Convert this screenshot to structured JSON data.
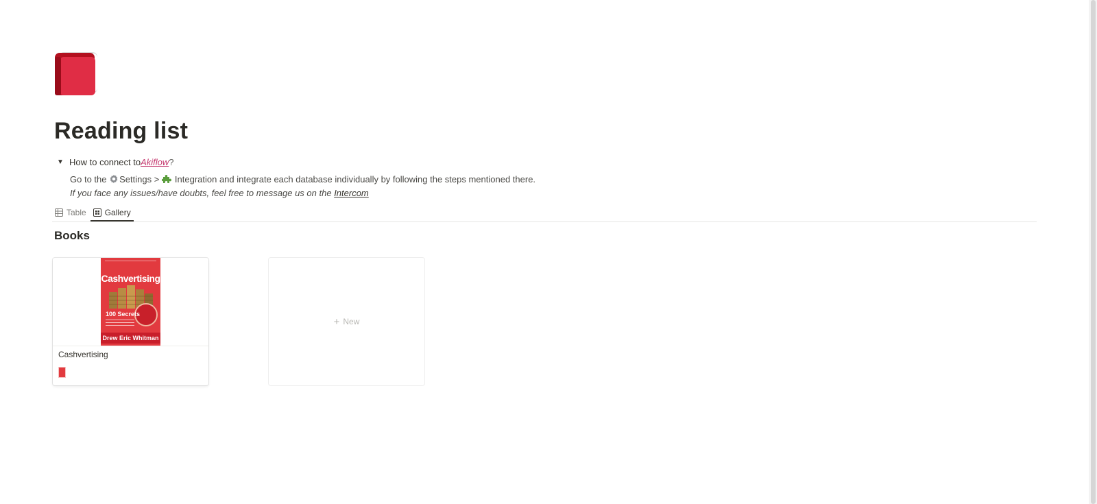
{
  "page": {
    "title": "Reading list",
    "icon": "red-book-icon"
  },
  "toggle": {
    "heading_prefix": "How to connect to ",
    "heading_link": "Akiflow",
    "heading_suffix": "?",
    "line1_prefix": "Go to the ",
    "line1_settings": "Settings",
    "line1_sep": " > ",
    "line1_rest": "Integration and integrate each database individually by following the steps mentioned there.",
    "line2_prefix": "If you face any issues/have doubts, feel free to message us on the ",
    "line2_link": "Intercom"
  },
  "tabs": [
    {
      "label": "Table",
      "icon": "table-icon",
      "active": false
    },
    {
      "label": "Gallery",
      "icon": "gallery-icon",
      "active": true
    }
  ],
  "section": {
    "title": "Books"
  },
  "gallery": {
    "cards": [
      {
        "name": "Cashvertising",
        "cover": {
          "title": "Cashvertising",
          "headline": "100 Secrets",
          "author": "Drew Eric Whitman"
        }
      }
    ],
    "new_label": "New"
  },
  "colors": {
    "link_pink": "#c4376d",
    "text": "#37352f",
    "cover_red": "#e23a3f"
  }
}
